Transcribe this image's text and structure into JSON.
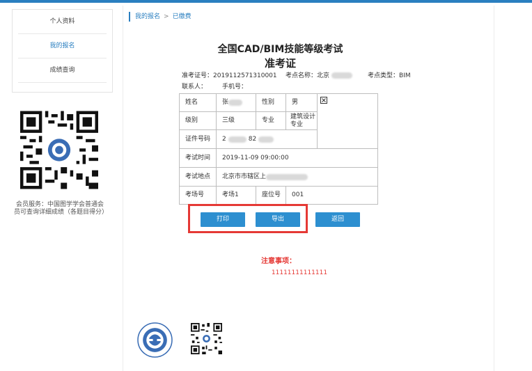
{
  "sidebar": {
    "items": [
      {
        "label": "个人资料",
        "active": false
      },
      {
        "label": "我的报名",
        "active": true
      },
      {
        "label": "成绩查询",
        "active": false
      }
    ],
    "member_note": "会员服务：中国图学学会普通会员可查询详细成绩（各题目得分）"
  },
  "breadcrumb": {
    "items": [
      "我的报名",
      "已缴费"
    ],
    "separator": ">"
  },
  "ticket": {
    "title": "全国CAD/BIM技能等级考试",
    "subtitle": "准考证",
    "exam_no_label": "准考证号：",
    "exam_no": "2019112571310001",
    "site_name_label": "考点名称：",
    "site_name": "北京",
    "site_type_label": "考点类型：",
    "site_type": "BIM",
    "contact_label": "联系人：",
    "phone_label": "手机号：",
    "fields": {
      "name_label": "姓名",
      "name_value": "张",
      "gender_label": "性别",
      "gender_value": "男",
      "level_label": "级别",
      "level_value": "三级",
      "major_label": "专业",
      "major_value": "建筑设计专业",
      "id_label": "证件号码",
      "id_value_a": "2",
      "id_value_b": "82",
      "time_label": "考试时间",
      "time_value": "2019-11-09 09:00:00",
      "address_label": "考试地点",
      "address_value": "北京市市辖区上",
      "room_label": "考场号",
      "room_value": "考场1",
      "seat_label": "座位号",
      "seat_value": "001"
    }
  },
  "actions": {
    "print": "打印",
    "export": "导出",
    "back": "返回"
  },
  "notice": {
    "title": "注意事项：",
    "text": "11111111111111"
  },
  "colors": {
    "accent": "#2a7fc0",
    "button": "#2d8fd0",
    "highlight": "#e53935"
  }
}
